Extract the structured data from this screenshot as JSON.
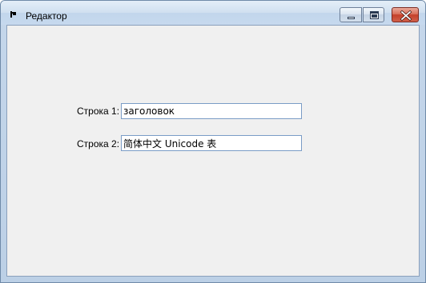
{
  "window": {
    "title": "Редактор"
  },
  "form": {
    "row1": {
      "label": "Строка 1:",
      "value": "заголовок"
    },
    "row2": {
      "label": "Строка 2:",
      "value": "简体中文 Unicode 表"
    }
  },
  "icons": {
    "app": "app-icon",
    "minimize": "minimize-icon",
    "maximize": "maximize-icon",
    "close": "close-icon"
  },
  "colors": {
    "close_button": "#c4402a",
    "client_background": "#f0f0f0",
    "field_border": "#7a9cc6"
  }
}
